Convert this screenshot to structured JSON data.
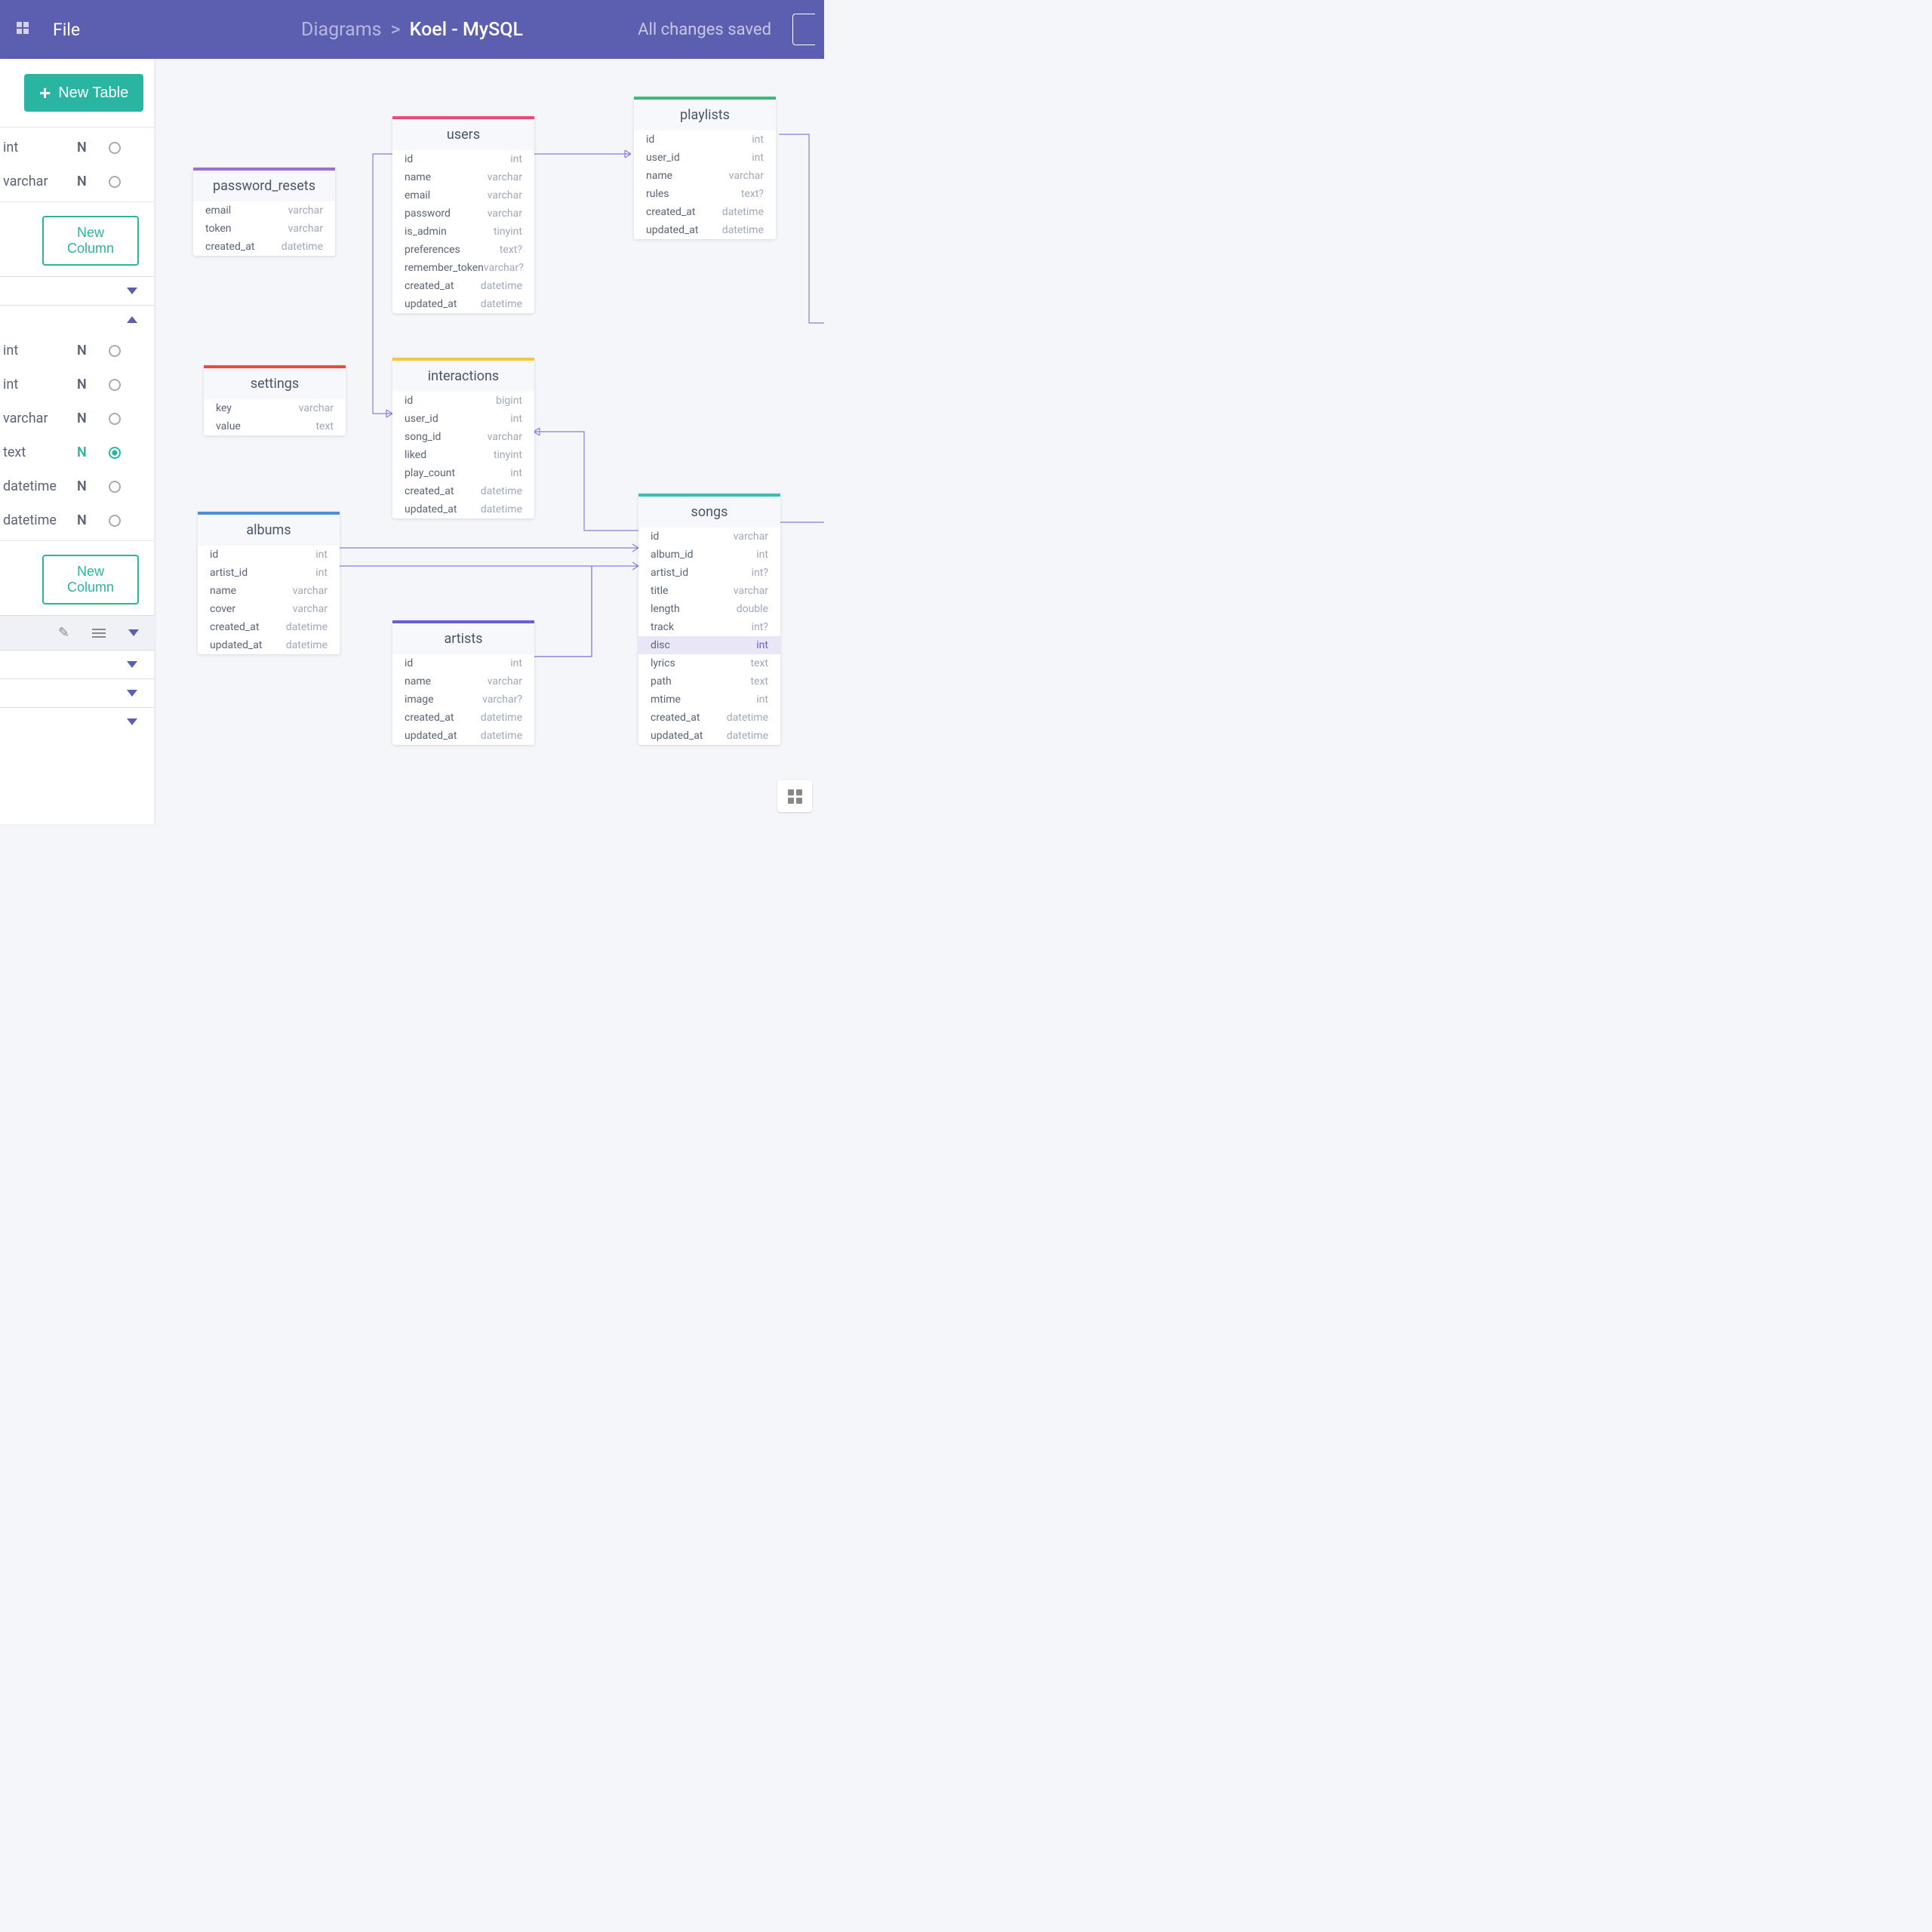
{
  "header": {
    "file_label": "File",
    "breadcrumb_parent": "Diagrams",
    "breadcrumb_sep": ">",
    "breadcrumb_current": "Koel - MySQL",
    "save_status": "All changes saved"
  },
  "sidebar": {
    "new_table_label": "New Table",
    "new_column_label": "New Column",
    "rows_a": [
      {
        "type": "int",
        "n": "N"
      },
      {
        "type": "varchar",
        "n": "N"
      }
    ],
    "rows_b": [
      {
        "type": "int",
        "n": "N"
      },
      {
        "type": "int",
        "n": "N"
      },
      {
        "type": "varchar",
        "n": "N"
      },
      {
        "type": "text",
        "n": "N",
        "active": true
      },
      {
        "type": "datetime",
        "n": "N"
      },
      {
        "type": "datetime",
        "n": "N"
      }
    ]
  },
  "tables": {
    "password_resets": {
      "title": "password_resets",
      "color": "#9b6dd7",
      "cols": [
        {
          "name": "email",
          "type": "varchar"
        },
        {
          "name": "token",
          "type": "varchar"
        },
        {
          "name": "created_at",
          "type": "datetime"
        }
      ]
    },
    "users": {
      "title": "users",
      "color": "#e94b77",
      "cols": [
        {
          "name": "id",
          "type": "int"
        },
        {
          "name": "name",
          "type": "varchar"
        },
        {
          "name": "email",
          "type": "varchar"
        },
        {
          "name": "password",
          "type": "varchar"
        },
        {
          "name": "is_admin",
          "type": "tinyint"
        },
        {
          "name": "preferences",
          "type": "text?"
        },
        {
          "name": "remember_token",
          "type": "varchar?"
        },
        {
          "name": "created_at",
          "type": "datetime"
        },
        {
          "name": "updated_at",
          "type": "datetime"
        }
      ]
    },
    "playlists": {
      "title": "playlists",
      "color": "#3cb878",
      "cols": [
        {
          "name": "id",
          "type": "int"
        },
        {
          "name": "user_id",
          "type": "int"
        },
        {
          "name": "name",
          "type": "varchar"
        },
        {
          "name": "rules",
          "type": "text?"
        },
        {
          "name": "created_at",
          "type": "datetime"
        },
        {
          "name": "updated_at",
          "type": "datetime"
        }
      ]
    },
    "settings": {
      "title": "settings",
      "color": "#e94b3c",
      "cols": [
        {
          "name": "key",
          "type": "varchar"
        },
        {
          "name": "value",
          "type": "text"
        }
      ]
    },
    "interactions": {
      "title": "interactions",
      "color": "#f4c842",
      "cols": [
        {
          "name": "id",
          "type": "bigint"
        },
        {
          "name": "user_id",
          "type": "int"
        },
        {
          "name": "song_id",
          "type": "varchar"
        },
        {
          "name": "liked",
          "type": "tinyint"
        },
        {
          "name": "play_count",
          "type": "int"
        },
        {
          "name": "created_at",
          "type": "datetime"
        },
        {
          "name": "updated_at",
          "type": "datetime"
        }
      ]
    },
    "albums": {
      "title": "albums",
      "color": "#4a90d9",
      "cols": [
        {
          "name": "id",
          "type": "int"
        },
        {
          "name": "artist_id",
          "type": "int"
        },
        {
          "name": "name",
          "type": "varchar"
        },
        {
          "name": "cover",
          "type": "varchar"
        },
        {
          "name": "created_at",
          "type": "datetime"
        },
        {
          "name": "updated_at",
          "type": "datetime"
        }
      ]
    },
    "artists": {
      "title": "artists",
      "color": "#6b5dd3",
      "cols": [
        {
          "name": "id",
          "type": "int"
        },
        {
          "name": "name",
          "type": "varchar"
        },
        {
          "name": "image",
          "type": "varchar?"
        },
        {
          "name": "created_at",
          "type": "datetime"
        },
        {
          "name": "updated_at",
          "type": "datetime"
        }
      ]
    },
    "songs": {
      "title": "songs",
      "color": "#3bbfad",
      "cols": [
        {
          "name": "id",
          "type": "varchar"
        },
        {
          "name": "album_id",
          "type": "int"
        },
        {
          "name": "artist_id",
          "type": "int?"
        },
        {
          "name": "title",
          "type": "varchar"
        },
        {
          "name": "length",
          "type": "double"
        },
        {
          "name": "track",
          "type": "int?"
        },
        {
          "name": "disc",
          "type": "int",
          "highlighted": true
        },
        {
          "name": "lyrics",
          "type": "text"
        },
        {
          "name": "path",
          "type": "text"
        },
        {
          "name": "mtime",
          "type": "int"
        },
        {
          "name": "created_at",
          "type": "datetime"
        },
        {
          "name": "updated_at",
          "type": "datetime"
        }
      ]
    }
  }
}
